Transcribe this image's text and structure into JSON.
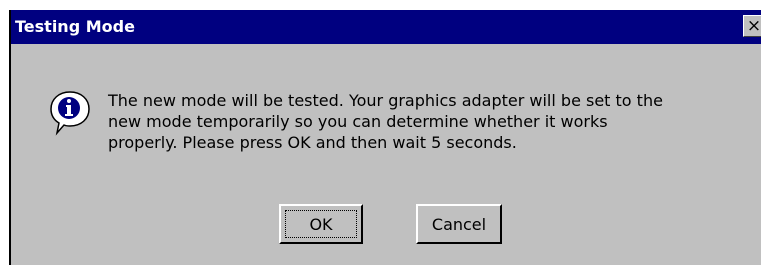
{
  "window": {
    "title": "Testing Mode",
    "close_glyph": "×"
  },
  "message": {
    "icon": "information-icon",
    "lines": [
      "The new mode will be tested.  Your graphics adapter will be set to the",
      "new mode temporarily so you can determine whether it works",
      "properly.  Please press OK and then wait 5 seconds."
    ]
  },
  "buttons": {
    "ok_label": "OK",
    "cancel_label": "Cancel"
  },
  "colors": {
    "titlebar": "#000080",
    "dialog_face": "#c0c0c0",
    "icon_fill": "#000080"
  }
}
